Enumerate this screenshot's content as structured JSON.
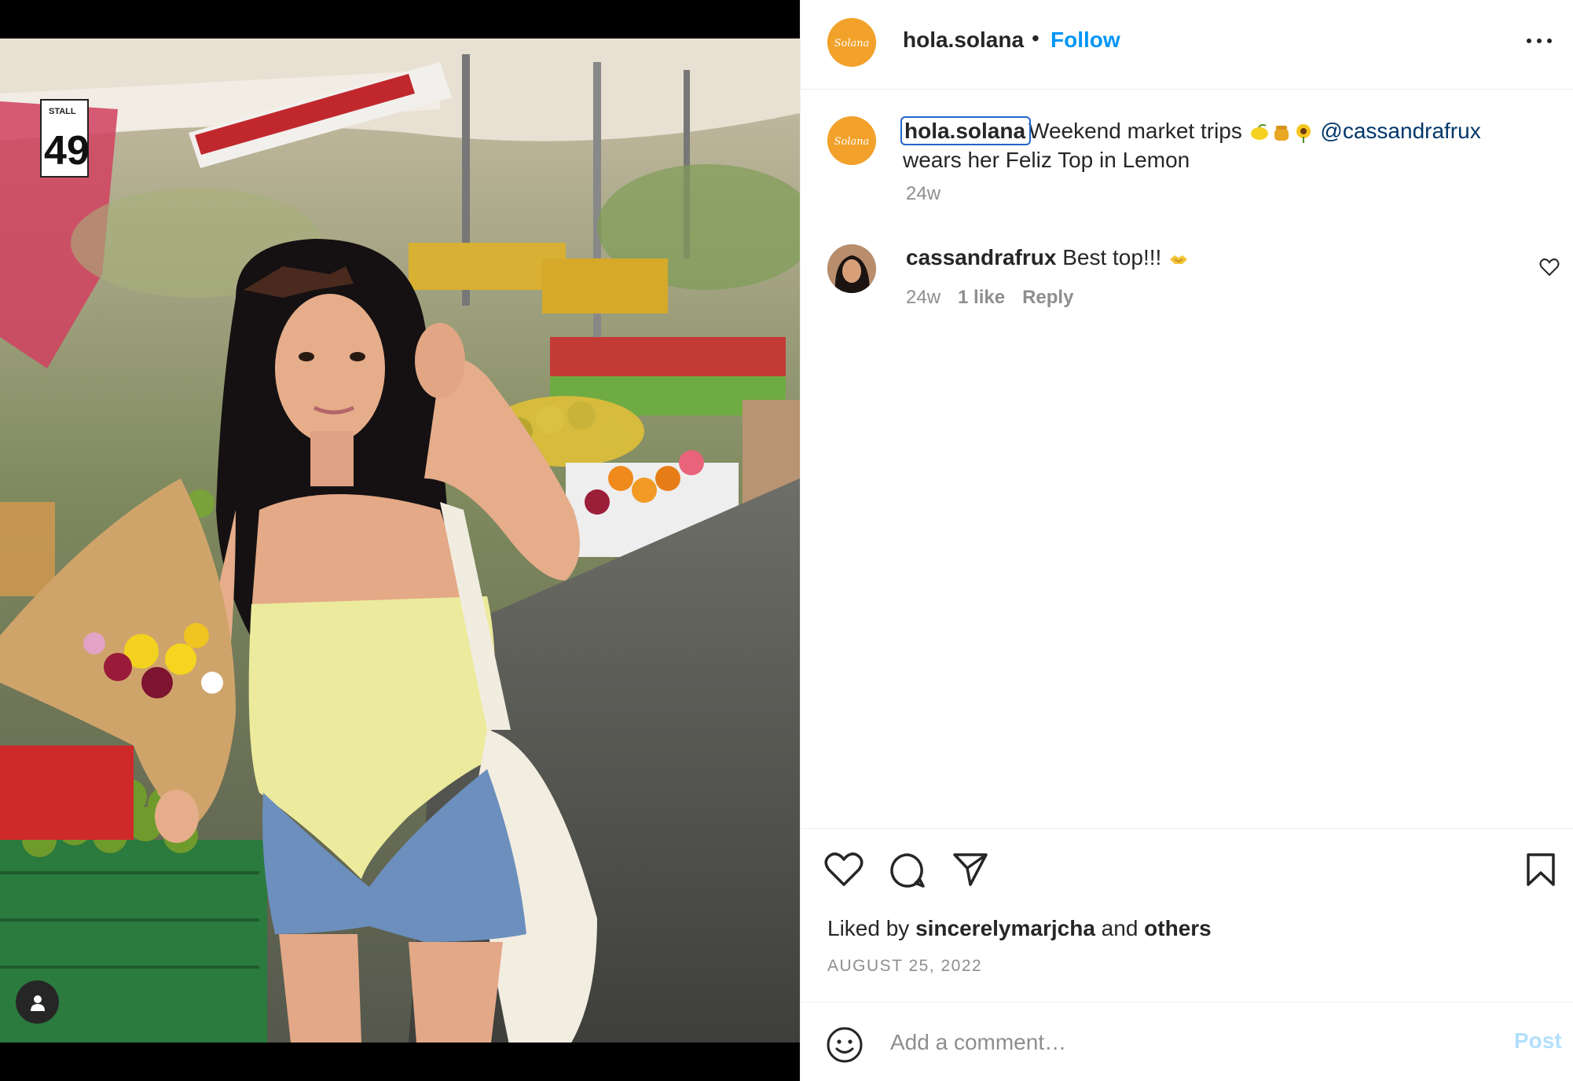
{
  "post": {
    "author": "hola.solana",
    "follow_label": "Follow",
    "separator": "•",
    "avatar_text": "Solana"
  },
  "caption": {
    "username": "hola.solana",
    "text_before": "Weekend market trips ",
    "emojis": [
      "lemon",
      "honey-pot",
      "sunflower"
    ],
    "mention": "@cassandrafrux",
    "text_after": "wears her Feliz Top in Lemon",
    "time": "24w"
  },
  "comment": {
    "username": "cassandrafrux",
    "text": "Best top!!! ",
    "emoji": "handshake",
    "time": "24w",
    "likes": "1 like",
    "reply_label": "Reply"
  },
  "likes": {
    "prefix": "Liked by ",
    "user": "sincerelymarjcha",
    "middle": " and ",
    "others": "others"
  },
  "date": "AUGUST 25, 2022",
  "comment_box": {
    "placeholder": "Add a comment…",
    "post_label": "Post"
  },
  "photo": {
    "stall_label": "STALL",
    "stall_number": "49"
  },
  "colors": {
    "link_blue": "#0095f6",
    "mention_blue": "#00376b",
    "brand_orange": "#f2a12a",
    "post_disabled": "#b2dffc",
    "secondary_text": "#8e8e8e"
  }
}
